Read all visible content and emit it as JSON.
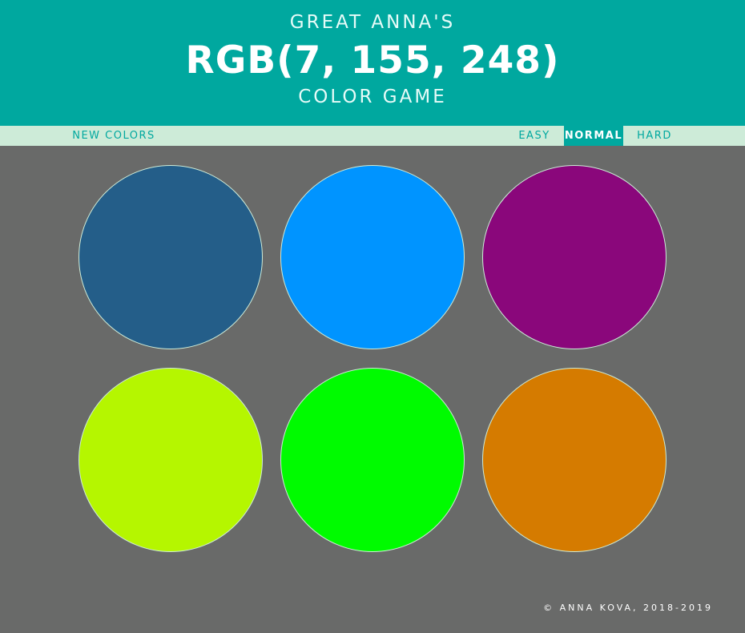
{
  "header": {
    "top_line": "GREAT ANNA'S",
    "rgb_display": "RGB(7, 155, 248)",
    "bottom_line": "COLOR GAME"
  },
  "nav": {
    "new_colors": "NEW COLORS",
    "easy": "EASY",
    "normal": "NORMAL",
    "hard": "HARD",
    "selected_mode": "NORMAL"
  },
  "squares": [
    {
      "color": "#245e89"
    },
    {
      "color": "#0094ff"
    },
    {
      "color": "#8a077b"
    },
    {
      "color": "#b5f600"
    },
    {
      "color": "#00fb00"
    },
    {
      "color": "#d57b00"
    }
  ],
  "footer": {
    "copyright": "© ANNA KOVA, 2018-2019"
  },
  "colors": {
    "header_bg": "#00a89f",
    "nav_bg": "#cdebd8",
    "body_bg": "#696a69",
    "accent": "#00a89f"
  }
}
